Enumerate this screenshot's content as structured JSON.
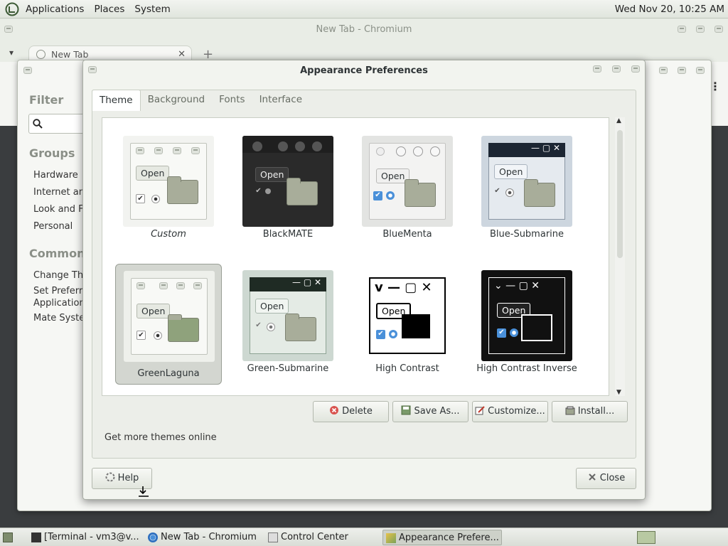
{
  "top_panel": {
    "menus": [
      "Applications",
      "Places",
      "System"
    ],
    "clock": "Wed Nov 20, 10:25 AM"
  },
  "chromium": {
    "title": "New Tab - Chromium",
    "tab_label": "New Tab",
    "tab_close": "✕",
    "new_tab": "+"
  },
  "control_center": {
    "filter_label": "Filter",
    "groups_label": "Groups",
    "group_items": [
      "Hardware",
      "Internet and",
      "Look and Fe",
      "Personal"
    ],
    "common_label": "Common T",
    "common_items": [
      "Change The",
      "Set Preferre",
      "Application",
      "Mate Syster"
    ]
  },
  "dialog": {
    "title": "Appearance Preferences",
    "tabs": [
      "Theme",
      "Background",
      "Fonts",
      "Interface"
    ],
    "active_tab": "Theme",
    "themes": [
      {
        "name": "Custom",
        "style": "custom"
      },
      {
        "name": "BlackMATE",
        "style": "blackmate"
      },
      {
        "name": "BlueMenta",
        "style": "bluementa"
      },
      {
        "name": "Blue-Submarine",
        "style": "bluesub"
      },
      {
        "name": "GreenLaguna",
        "style": "greenlaguna",
        "selected": true
      },
      {
        "name": "Green-Submarine",
        "style": "greensub"
      },
      {
        "name": "High Contrast",
        "style": "hc"
      },
      {
        "name": "High Contrast Inverse",
        "style": "hci"
      }
    ],
    "thumb_open_label": "Open",
    "buttons": {
      "delete": "Delete",
      "save_as": "Save As...",
      "customize": "Customize...",
      "install": "Install..."
    },
    "get_more": "Get more themes online",
    "help": "Help",
    "close": "Close"
  },
  "taskbar": {
    "tasks": [
      "[Terminal - vm3@v...",
      "New Tab - Chromium",
      "Control Center",
      "Appearance Prefere..."
    ]
  },
  "colors": {
    "accent": "#4a90d9",
    "delete_red": "#d9534f"
  }
}
